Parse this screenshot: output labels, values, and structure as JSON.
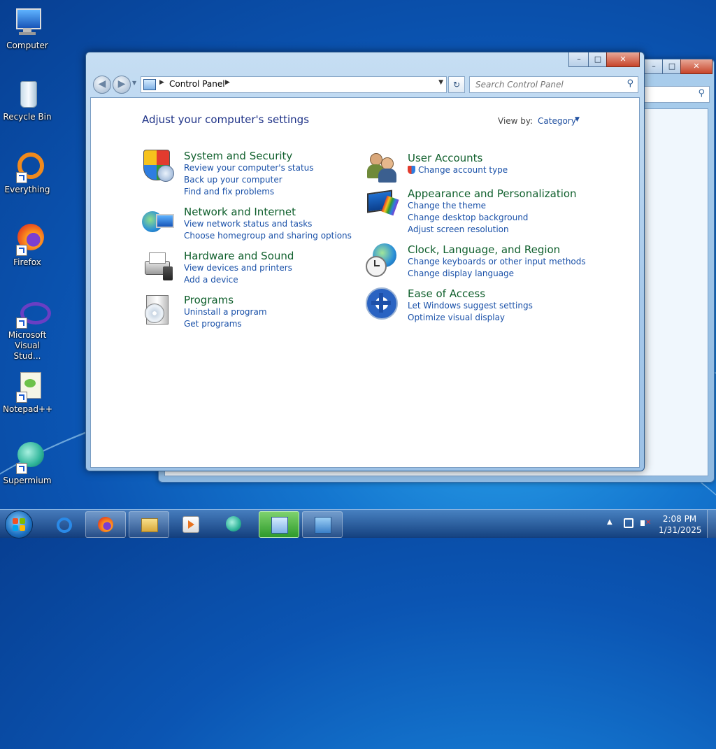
{
  "desktop": {
    "icons": [
      {
        "label": "Computer"
      },
      {
        "label": "Recycle Bin"
      },
      {
        "label": "Everything"
      },
      {
        "label": "Firefox"
      },
      {
        "label": "Microsoft Visual Stud..."
      },
      {
        "label": "Notepad++"
      },
      {
        "label": "Supermium"
      }
    ]
  },
  "window": {
    "caption": {
      "minimize": "–",
      "maximize": "□",
      "close": "✕"
    },
    "breadcrumb": "Control Panel",
    "search_placeholder": "Search Control Panel",
    "page_title": "Adjust your computer's settings",
    "view_by_label": "View by:",
    "view_by_value": "Category",
    "categories_left": [
      {
        "title": "System and Security",
        "links": [
          "Review your computer's status",
          "Back up your computer",
          "Find and fix problems"
        ]
      },
      {
        "title": "Network and Internet",
        "links": [
          "View network status and tasks",
          "Choose homegroup and sharing options"
        ]
      },
      {
        "title": "Hardware and Sound",
        "links": [
          "View devices and printers",
          "Add a device"
        ]
      },
      {
        "title": "Programs",
        "links": [
          "Uninstall a program",
          "Get programs"
        ]
      }
    ],
    "categories_right": [
      {
        "title": "User Accounts",
        "links": [
          "Change account type"
        ]
      },
      {
        "title": "Appearance and Personalization",
        "links": [
          "Change the theme",
          "Change desktop background",
          "Adjust screen resolution"
        ]
      },
      {
        "title": "Clock, Language, and Region",
        "links": [
          "Change keyboards or other input methods",
          "Change display language"
        ]
      },
      {
        "title": "Ease of Access",
        "links": [
          "Let Windows suggest settings",
          "Optimize visual display"
        ]
      }
    ]
  },
  "taskbar": {
    "time": "2:08 PM",
    "date": "1/31/2025",
    "items": [
      "internet-explorer",
      "firefox",
      "file-explorer",
      "media-player",
      "supermium",
      "control-panel",
      "remote-desktop"
    ]
  }
}
